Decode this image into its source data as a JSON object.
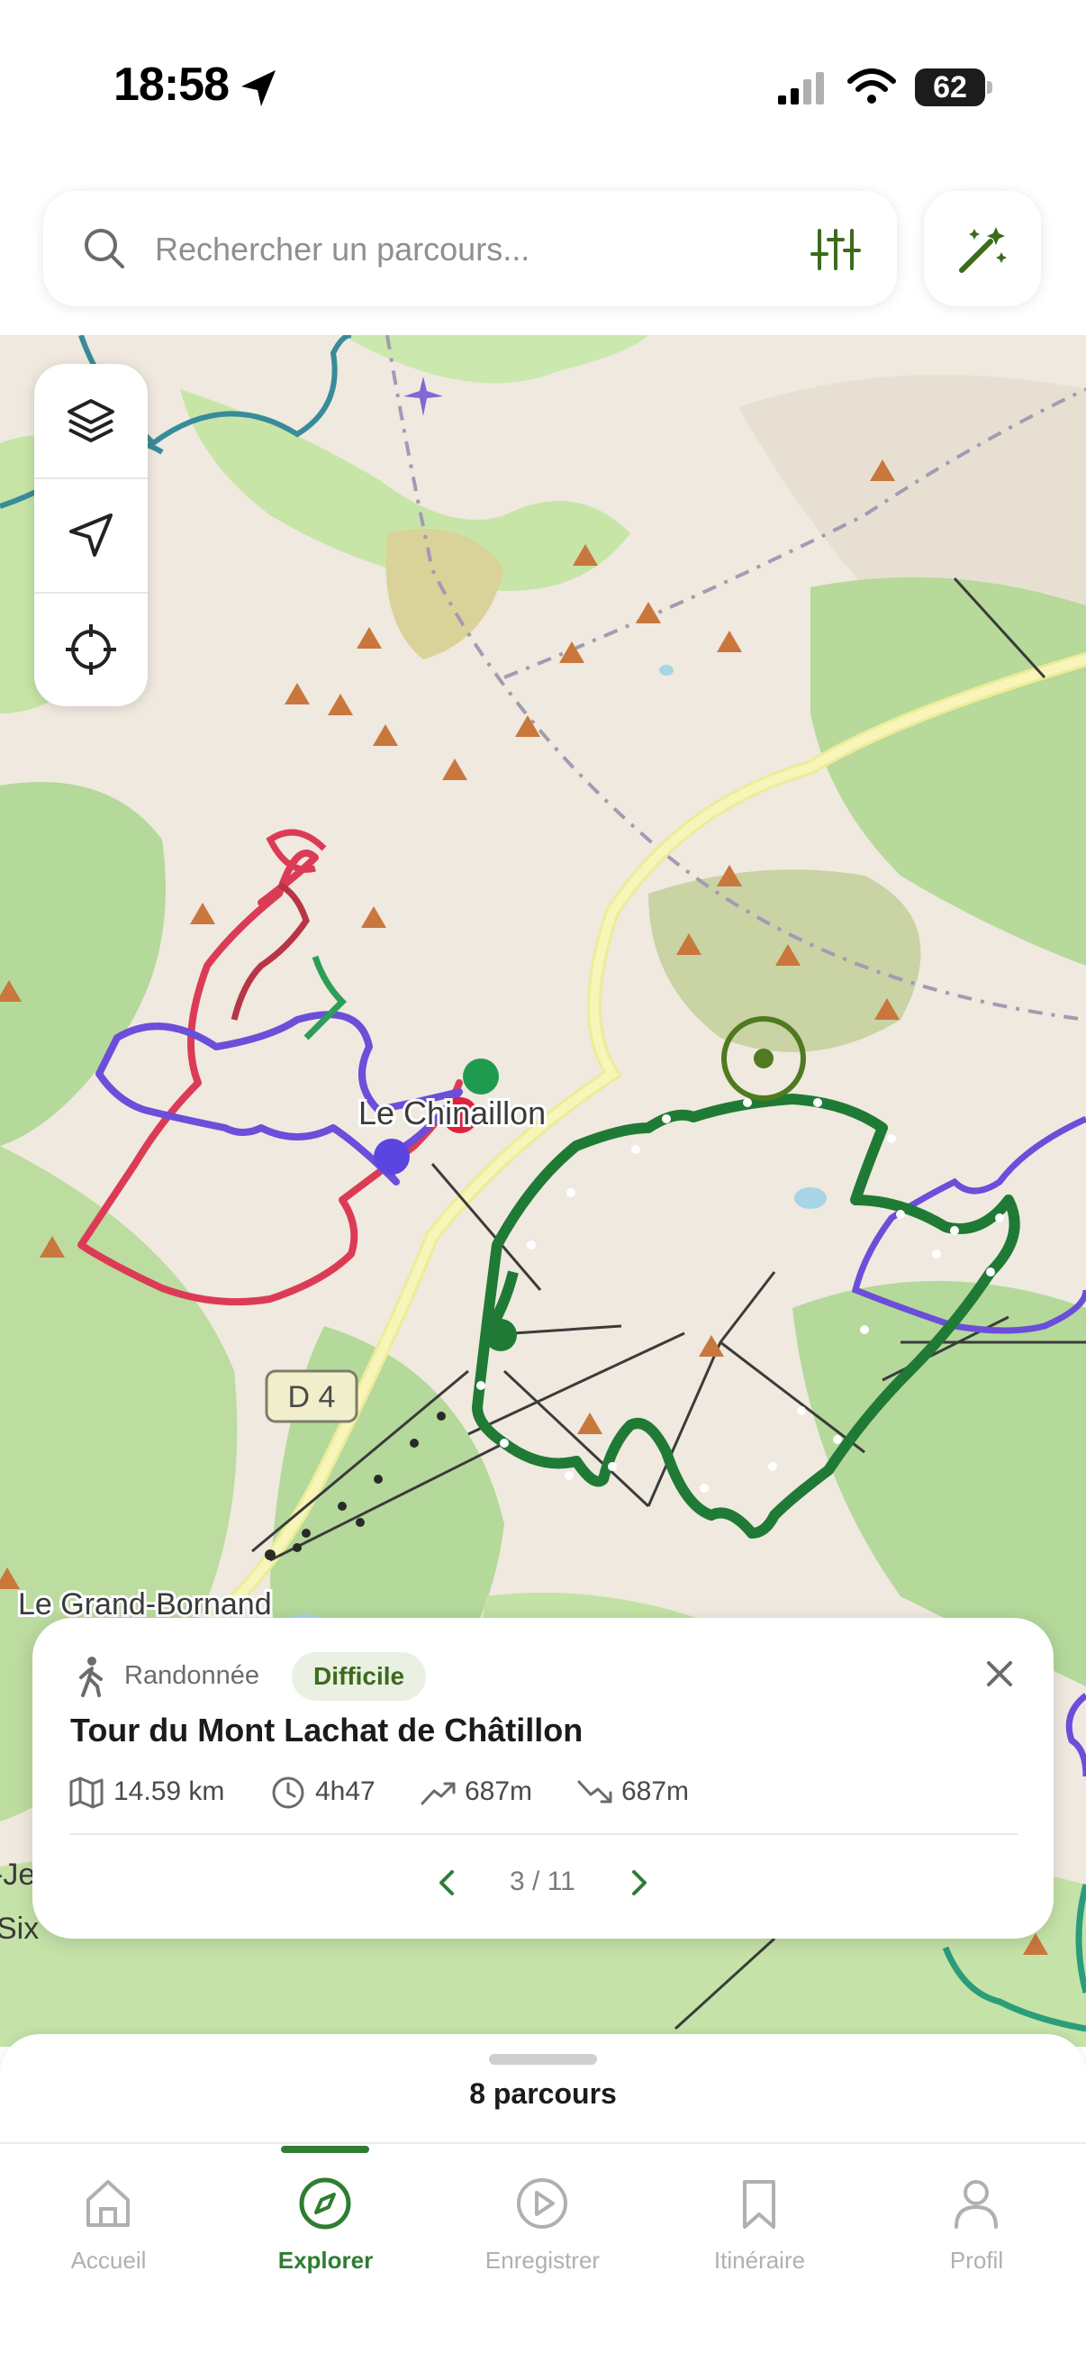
{
  "status_bar": {
    "time": "18:58",
    "battery": "62"
  },
  "search": {
    "placeholder": "Rechercher un parcours..."
  },
  "map": {
    "labels": {
      "town_center": "Le Chinaillon",
      "road": "D 4",
      "town_bottom": "Le Grand-Bornand",
      "edge_1": "-Je",
      "edge_2": "Six"
    }
  },
  "route_card": {
    "activity": "Randonnée",
    "difficulty": "Difficile",
    "title": "Tour du Mont Lachat de Châtillon",
    "distance": "14.59 km",
    "duration": "4h47",
    "elevation_gain": "687m",
    "elevation_loss": "687m",
    "pager": "3 / 11"
  },
  "sheet": {
    "count": "8 parcours"
  },
  "tabs": [
    {
      "label": "Accueil"
    },
    {
      "label": "Explorer"
    },
    {
      "label": "Enregistrer"
    },
    {
      "label": "Itinéraire"
    },
    {
      "label": "Profil"
    }
  ],
  "colors": {
    "accent": "#2e7d32",
    "route_green": "#1f7a35",
    "route_red": "#d9304b",
    "route_purple": "#6a4fd8"
  }
}
